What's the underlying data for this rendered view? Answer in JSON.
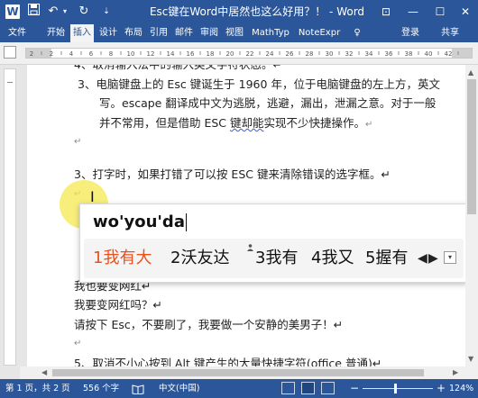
{
  "titlebar": {
    "doc_title": "Esc键在Word中居然也这么好用？！ - Word",
    "word_logo": "W",
    "save_glyph": "💾",
    "undo_glyph": "↶",
    "undo_dropdown_glyph": "▾",
    "redo_glyph": "↻",
    "qat_dropdown_glyph": "⇣",
    "ribbon_display_glyph": "⊡",
    "minimize_glyph": "—",
    "maximize_glyph": "☐",
    "close_glyph": "✕"
  },
  "tabs": [
    {
      "label": "文件",
      "active": false
    },
    {
      "label": "开始",
      "active": false
    },
    {
      "label": "插入",
      "active": true
    },
    {
      "label": "设计",
      "active": false
    },
    {
      "label": "布局",
      "active": false
    },
    {
      "label": "引用",
      "active": false
    },
    {
      "label": "邮件",
      "active": false
    },
    {
      "label": "审阅",
      "active": false
    },
    {
      "label": "视图",
      "active": false
    },
    {
      "label": "MathTyp",
      "active": false
    },
    {
      "label": "NoteExpr",
      "active": false
    },
    {
      "label": "♀",
      "active": false
    },
    {
      "label": "登录",
      "active": false
    },
    {
      "label": "共享",
      "active": false
    }
  ],
  "ruler": {
    "numbers": [
      "2",
      "2",
      "4",
      "6",
      "8",
      "10",
      "12",
      "14",
      "16",
      "18",
      "20",
      "22",
      "24",
      "26",
      "28",
      "30",
      "32",
      "34",
      "36",
      "38",
      "40",
      "42"
    ]
  },
  "document": {
    "lines": [
      "4、取消输入法中的输入英文字符状态。↵",
      "3、电脑键盘上的 Esc 键诞生于 1960 年，位于电脑键盘的左上方，英文",
      "写。escape 翻译成中文为逃脱，逃避，漏出，泄漏之意。对于一般",
      "并不常用，但是借助 ESC 键却能实现不少快捷操作。↵",
      "↵",
      "3、打字时，如果打错了可以按 ESC 键来清除错误的选字框。↵",
      "↵",
      "我也要变网红↵",
      "我要变网红吗？↵",
      "请按下 Esc，不要刷了，我要做一个安静的美男子！↵",
      "↵",
      "5、取消不小心按到 Alt 键产生的大量快捷字符(office 普通)↵"
    ],
    "squiggle_word": "键却能",
    "pilcrow_small": "↵"
  },
  "ime": {
    "composition": "wo'you'da",
    "candidates": [
      "1我有大",
      "2沃友达",
      "3我有",
      "4我又",
      "5握有"
    ],
    "selected_index": 0,
    "user_icon": "👤",
    "prev_glyph": "◀",
    "next_glyph": "▶",
    "expand_glyph": "▾"
  },
  "scroll": {
    "up_glyph": "▲",
    "down_glyph": "▼",
    "left_glyph": "◀",
    "right_glyph": "▶"
  },
  "statusbar": {
    "page": "第 1 页，共 2 页",
    "words": "556 个字",
    "proofing_glyph": "📖",
    "language": "中文(中国)",
    "view_glyph": "▤",
    "zoom_minus": "−",
    "zoom_plus": "+",
    "zoom": "124%"
  },
  "colors": {
    "brand": "#2b579a",
    "ime_selected": "#e8511c",
    "highlight": "#f5e850"
  }
}
